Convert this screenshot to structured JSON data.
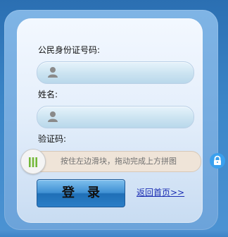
{
  "form": {
    "id_label": "公民身份证号码:",
    "name_label": "姓名:",
    "captcha_label": "验证码:",
    "id_value": "",
    "name_value": ""
  },
  "slider": {
    "hint": "按住左边滑块，拖动完成上方拼图",
    "progress": 0
  },
  "actions": {
    "login_label": "登录",
    "return_link": "返回首页>>"
  },
  "icons": {
    "field_icon": "user-icon",
    "slider_icon": "slider-handle-icon",
    "lock_icon": "lock-icon"
  },
  "colors": {
    "background": "#3b86c8",
    "panel": "#eef5ff",
    "button": "#2b7ec7",
    "slider_track": "#efe4d8",
    "slider_bars": "#73b838",
    "lock": "#3aa0ee",
    "link": "#1b2db3"
  }
}
